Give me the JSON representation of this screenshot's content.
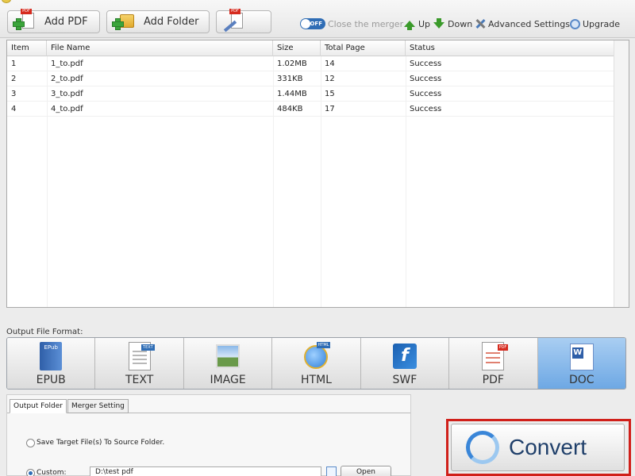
{
  "toolbar": {
    "add_pdf": "Add PDF",
    "add_folder": "Add Folder",
    "toggle_state": "OFF",
    "close_merger": "Close the merger",
    "up": "Up",
    "down": "Down",
    "advanced_settings": "Advanced Settings",
    "upgrade": "Upgrade"
  },
  "filelist": {
    "headers": [
      "Item",
      "File Name",
      "Size",
      "Total Page",
      "Status"
    ],
    "rows": [
      {
        "item": "1",
        "name": "1_to.pdf",
        "size": "1.02MB",
        "pages": "14",
        "status": "Success"
      },
      {
        "item": "2",
        "name": "2_to.pdf",
        "size": "331KB",
        "pages": "12",
        "status": "Success"
      },
      {
        "item": "3",
        "name": "3_to.pdf",
        "size": "1.44MB",
        "pages": "15",
        "status": "Success"
      },
      {
        "item": "4",
        "name": "4_to.pdf",
        "size": "484KB",
        "pages": "17",
        "status": "Success"
      }
    ]
  },
  "output_format": {
    "label": "Output File Format:",
    "formats": [
      "EPUB",
      "TEXT",
      "IMAGE",
      "HTML",
      "SWF",
      "PDF",
      "DOC"
    ],
    "selected": "DOC",
    "icon_texts": {
      "epub": "EPub",
      "text": "TEXT",
      "html": "HTML",
      "pdf": "PDF",
      "swf": "f",
      "doc": "W"
    }
  },
  "bottom": {
    "tabs": [
      "Output Folder",
      "Merger Setting"
    ],
    "save_to_source": "Save Target File(s) To Source Folder.",
    "custom_label": "Custom:",
    "custom_path": "D:\\test pdf",
    "open_button": "Open"
  },
  "convert": {
    "label": "Convert"
  },
  "colors": {
    "accent": "#2f6db5",
    "highlight_frame": "#d0201a",
    "selected_format": "#8dbdee"
  }
}
